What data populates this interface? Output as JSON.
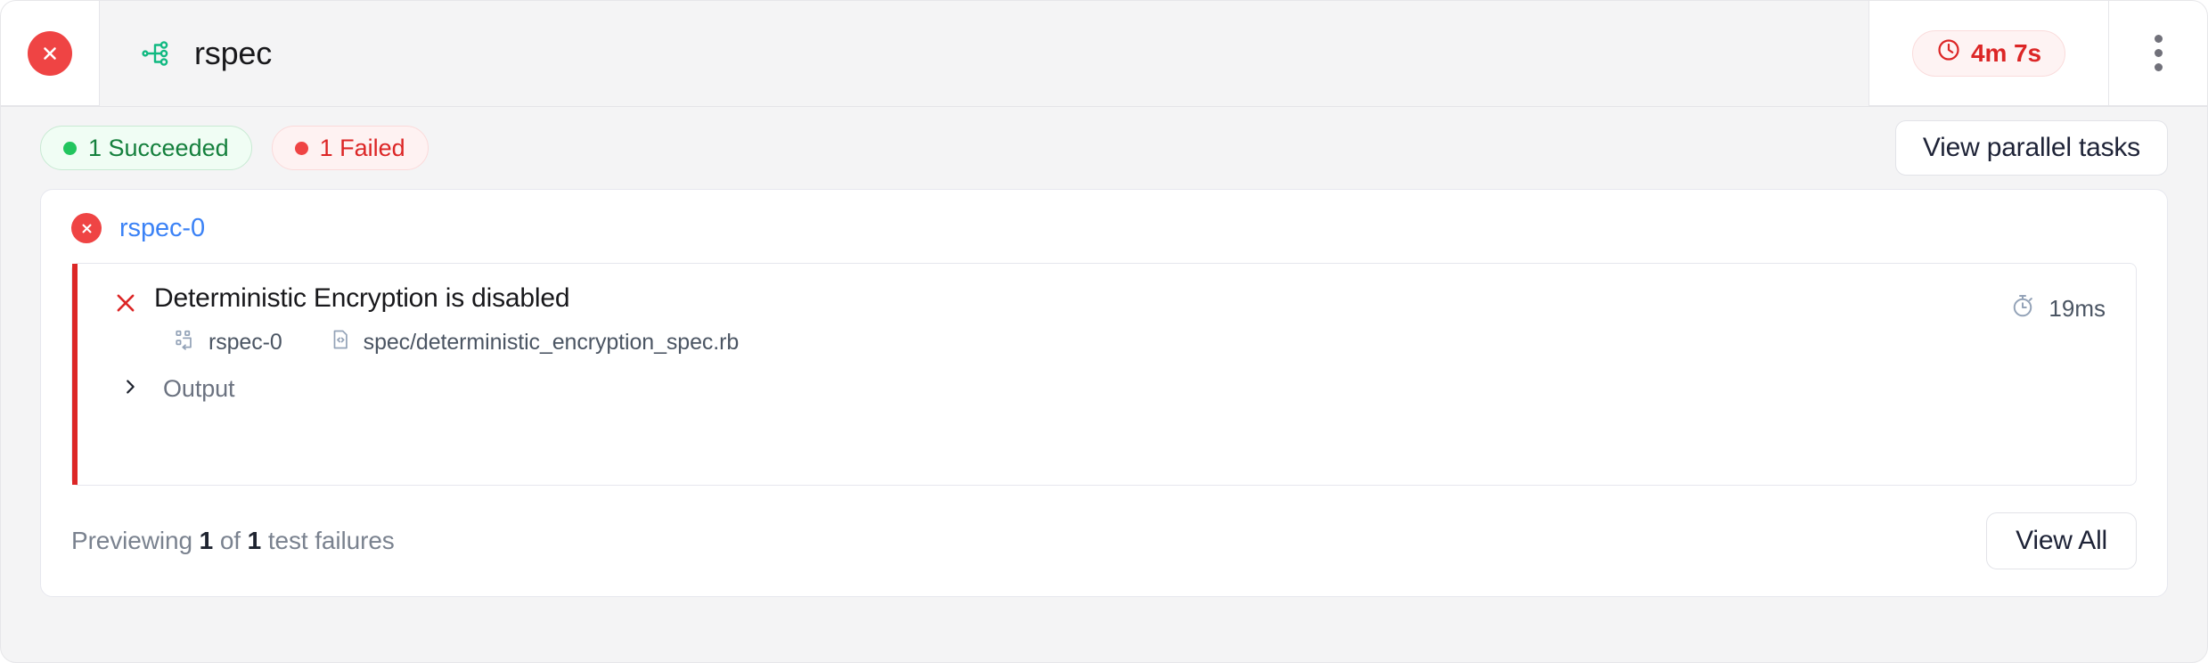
{
  "header": {
    "status_icon": "x-circle-icon",
    "status_color": "#ef4444",
    "pipeline_icon": "fan-out-branch-icon",
    "pipeline_icon_color": "#10b981",
    "title": "rspec",
    "duration": "4m 7s",
    "duration_icon": "clock-icon",
    "duration_color": "#dc2626",
    "menu_icon": "kebab-menu-icon"
  },
  "status_strip": {
    "pills": [
      {
        "label": "1 Succeeded",
        "state": "succeeded",
        "color": "#15803d"
      },
      {
        "label": "1 Failed",
        "state": "failed",
        "color": "#dc2626"
      }
    ],
    "parallel_button": "View parallel tasks"
  },
  "results": {
    "task": {
      "status_icon": "x-circle-icon",
      "name": "rspec-0"
    },
    "failure": {
      "icon": "x-icon",
      "title": "Deterministic Encryption is disabled",
      "task_icon": "partition-node-icon",
      "task_label": "rspec-0",
      "file_icon": "code-file-icon",
      "file_path": "spec/deterministic_encryption_spec.rb",
      "duration_icon": "stopwatch-icon",
      "duration": "19ms",
      "output_toggle_icon": "chevron-right-icon",
      "output_label": "Output"
    },
    "footer": {
      "preview_prefix": "Previewing",
      "preview_shown": "1",
      "preview_middle": "of",
      "preview_total": "1",
      "preview_suffix": "test failures",
      "view_all_button": "View All"
    }
  }
}
